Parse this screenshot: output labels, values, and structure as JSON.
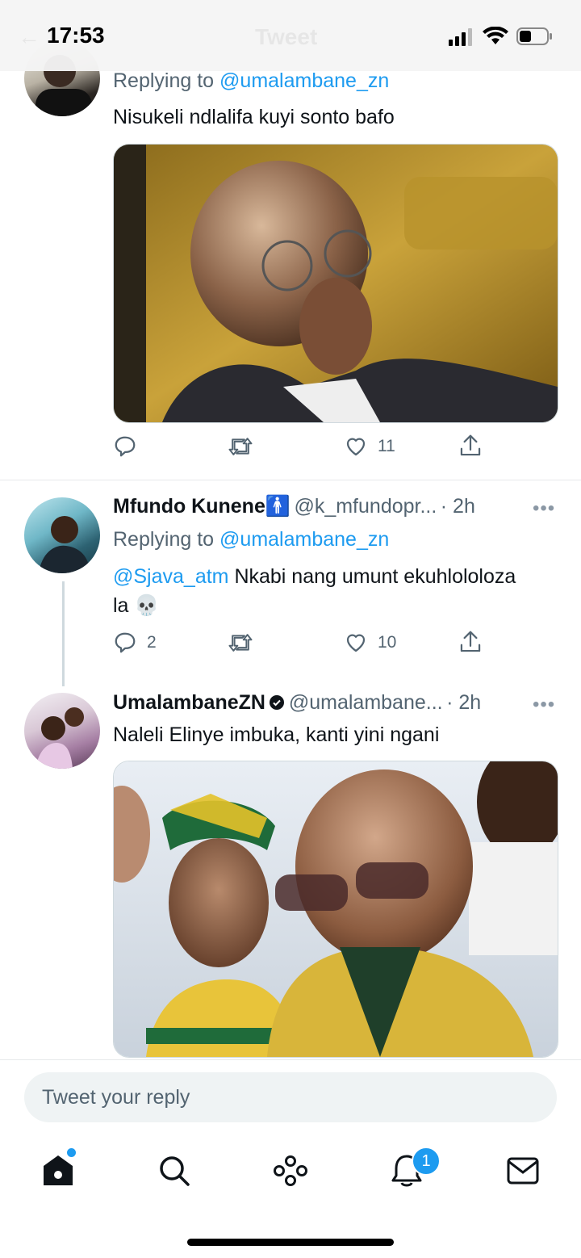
{
  "status_bar": {
    "time": "17:53",
    "header_title": "Tweet"
  },
  "tweets": [
    {
      "replying_prefix": "Replying to ",
      "replying_to": "@umalambane_zn",
      "text": "Nisukeli ndlalifa kuyi sonto bafo",
      "reply_count": "",
      "retweet_count": "",
      "like_count": "11"
    },
    {
      "display_name": "Mfundo Kunene",
      "emoji": "🚹",
      "handle": "@k_mfundopr...",
      "time": "· 2h",
      "replying_prefix": "Replying to ",
      "replying_to": "@umalambane_zn",
      "mention": "@Sjava_atm",
      "text_line1": " Nkabi nang umunt ekuhlololoza",
      "text_line2": "la 💀",
      "reply_count": "2",
      "retweet_count": "",
      "like_count": "10"
    },
    {
      "display_name": "UmalambaneZN",
      "handle": "@umalambane...",
      "time": "· 2h",
      "text": "Naleli Elinye imbuka, kanti yini ngani"
    }
  ],
  "reply_box": {
    "placeholder": "Tweet your reply"
  },
  "tab_bar": {
    "items": [
      "home-icon",
      "search-icon",
      "spaces-icon",
      "notifications-icon",
      "messages-icon"
    ],
    "notification_badge": "1"
  },
  "colors": {
    "accent": "#1d9bf0",
    "text": "#0f1419",
    "muted": "#536471"
  }
}
